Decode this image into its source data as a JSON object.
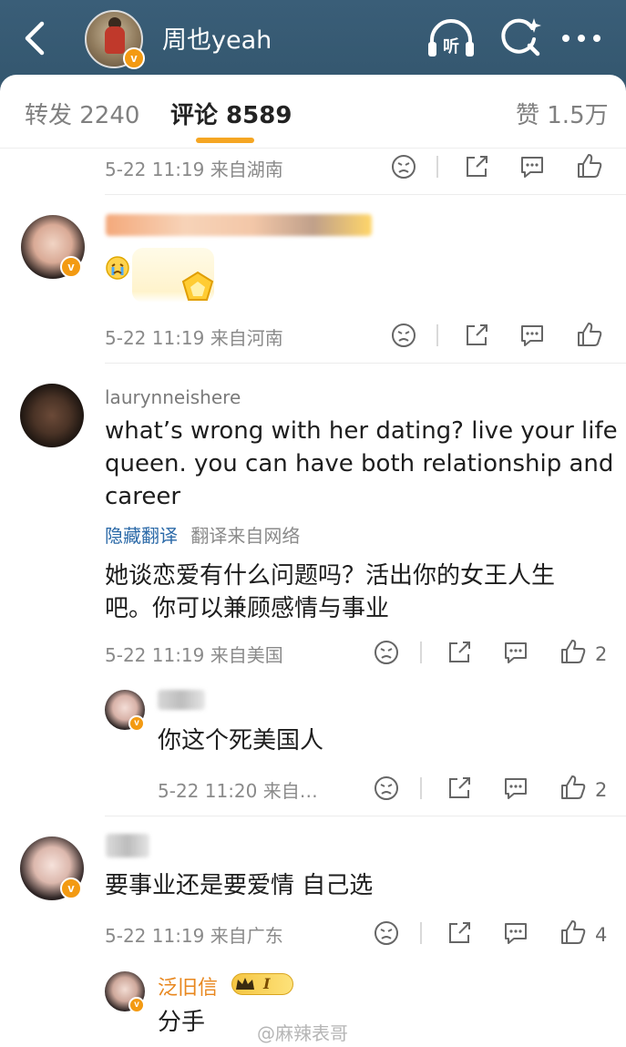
{
  "header": {
    "title": "周也yeah",
    "verified_badge": "v",
    "icons": {
      "back": "back-arrow-icon",
      "listen": "listen-headphones-icon",
      "search": "search-icon",
      "more": "more-icon"
    },
    "listen_label": "听"
  },
  "tabs": [
    {
      "label": "转发 2240",
      "active": false
    },
    {
      "label": "评论 8589",
      "active": true
    },
    {
      "label": "赞 1.5万",
      "active": false
    }
  ],
  "comments": [
    {
      "meta": "5-22 11:19  来自湖南",
      "likes": ""
    },
    {
      "meta": "5-22 11:19  来自河南",
      "likes": ""
    },
    {
      "username": "laurynneishere",
      "text_lines": [
        "what’s wrong with her dating? live your life",
        "queen. you can have both relationship and",
        "career"
      ],
      "hide_translation": "隐藏翻译",
      "translation_source": "翻译来自网络",
      "translation_lines": [
        "她谈恋爱有什么问题吗？活出你的女王人生",
        "吧。你可以兼顾感情与事业"
      ],
      "meta": "5-22 11:19  来自美国",
      "likes": "2",
      "reply": {
        "text": "你这个死美国人",
        "meta": "5-22 11:20  来自…",
        "likes": "2"
      }
    },
    {
      "text": "要事业还是要爱情 自己选",
      "meta": "5-22 11:19  来自广东",
      "likes": "4",
      "reply": {
        "username": "泛旧信",
        "level_badge": "I",
        "text": "分手"
      }
    }
  ],
  "watermark": "@麻辣表哥",
  "colors": {
    "accent": "#f5a623",
    "header_bg": "#3a5e78",
    "verified": "#f39a12",
    "link": "#2c6aa8"
  }
}
